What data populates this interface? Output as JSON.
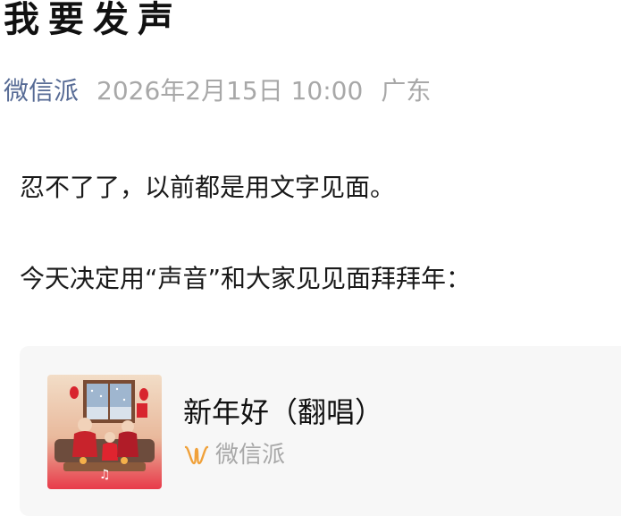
{
  "article": {
    "title": "我要发声",
    "account_name": "微信派",
    "date": "2026年2月15日 10:00",
    "location": "广东",
    "paragraphs": [
      "忍不了了，以前都是用文字见面。",
      "今天决定用“声音”和大家见见面拜拜年："
    ]
  },
  "music_card": {
    "song_title": "新年好（翻唱）",
    "source_name": "微信派",
    "cover_icon": "new-year-family-illustration",
    "source_icon": "wave-logo-icon",
    "colors": {
      "card_background": "#f7f7f7",
      "icon_orange": "#f0a13a",
      "account_link": "#576b95",
      "meta_gray": "#a8a8a8"
    }
  }
}
